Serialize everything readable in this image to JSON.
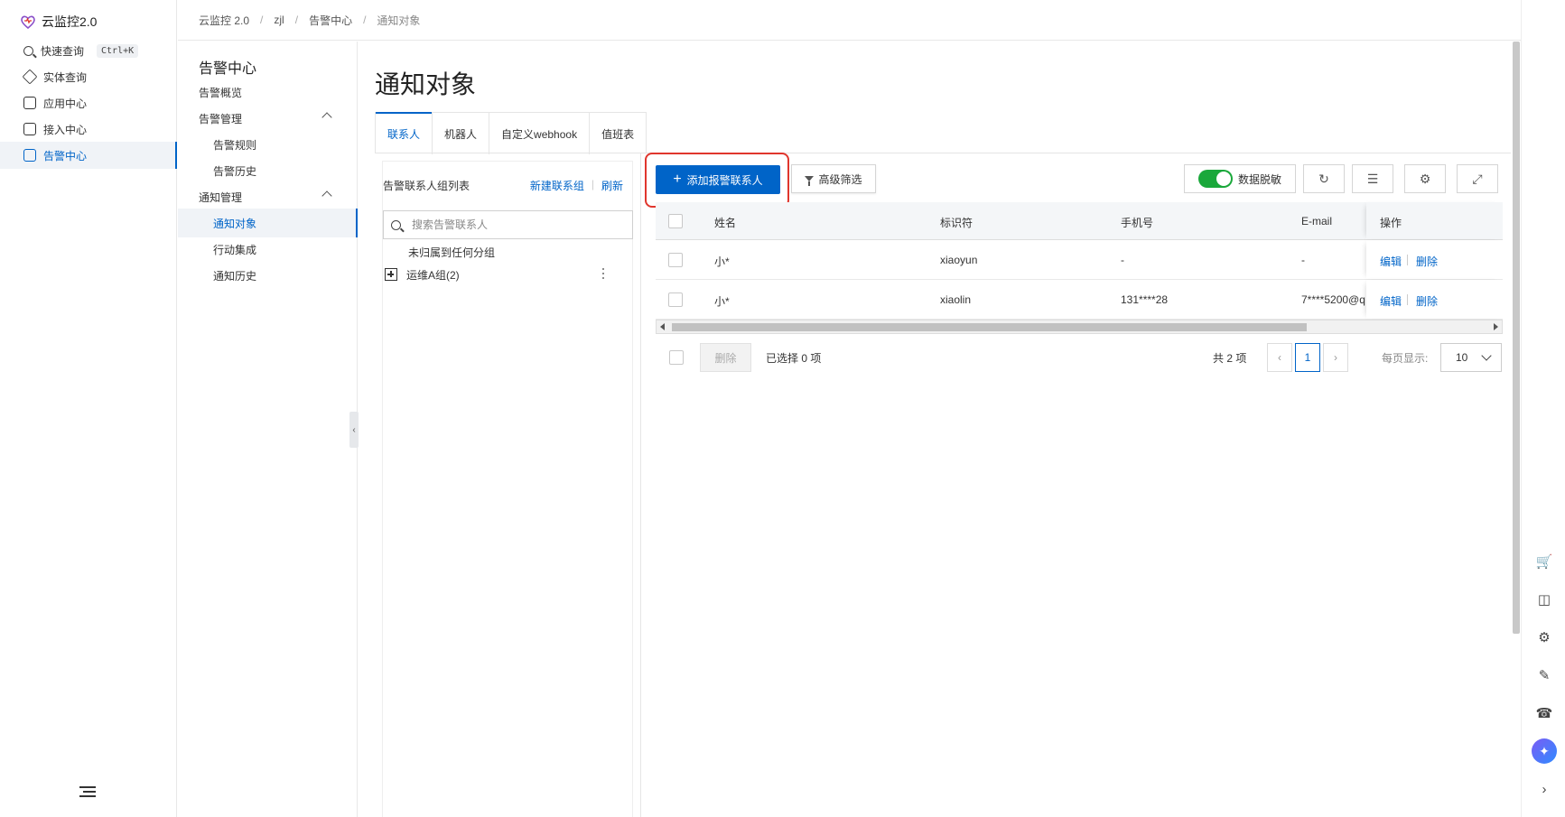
{
  "app": {
    "title": "云监控2.0"
  },
  "global_nav": {
    "items": [
      {
        "label": "快速查询",
        "shortcut": "Ctrl+K"
      },
      {
        "label": "实体查询"
      },
      {
        "label": "应用中心"
      },
      {
        "label": "接入中心"
      },
      {
        "label": "告警中心",
        "active": true
      }
    ]
  },
  "breadcrumb": [
    "云监控 2.0",
    "zjl",
    "告警中心",
    "通知对象"
  ],
  "subnav": {
    "title": "告警中心",
    "items": [
      {
        "label": "告警概览",
        "level": 1
      },
      {
        "label": "告警管理",
        "level": 1,
        "expandable": true
      },
      {
        "label": "告警规则",
        "level": 2
      },
      {
        "label": "告警历史",
        "level": 2
      },
      {
        "label": "通知管理",
        "level": 1,
        "expandable": true
      },
      {
        "label": "通知对象",
        "level": 2,
        "active": true
      },
      {
        "label": "行动集成",
        "level": 2
      },
      {
        "label": "通知历史",
        "level": 2
      }
    ]
  },
  "page": {
    "title": "通知对象"
  },
  "tabs": [
    {
      "label": "联系人",
      "active": true
    },
    {
      "label": "机器人"
    },
    {
      "label": "自定义webhook"
    },
    {
      "label": "值班表"
    }
  ],
  "group_panel": {
    "title": "告警联系人组列表",
    "new_group": "新建联系组",
    "refresh": "刷新",
    "search_placeholder": "搜索告警联系人",
    "ungrouped": "未归属到任何分组",
    "groups": [
      {
        "name": "运维A组(2)"
      }
    ]
  },
  "toolbar": {
    "add_contact": "添加报警联系人",
    "advanced_filter": "高级筛选",
    "data_masking": "数据脱敏",
    "data_masking_on": true
  },
  "table": {
    "columns": [
      "姓名",
      "标识符",
      "手机号",
      "E-mail",
      "操作"
    ],
    "rows": [
      {
        "name": "小*",
        "id": "xiaoyun",
        "phone": "-",
        "email": "-",
        "edit": "编辑",
        "delete": "删除"
      },
      {
        "name": "小*",
        "id": "xiaolin",
        "phone": "131****28",
        "email": "7****5200@q",
        "edit": "编辑",
        "delete": "删除"
      }
    ]
  },
  "footer": {
    "delete": "删除",
    "selected": "已选择 0 项",
    "total": "共 2 项",
    "current_page": "1",
    "page_size_label": "每页显示:",
    "page_size": "10"
  },
  "colors": {
    "primary": "#0064c8",
    "highlight": "#e0362d",
    "toggle_on": "#1aa83b"
  }
}
